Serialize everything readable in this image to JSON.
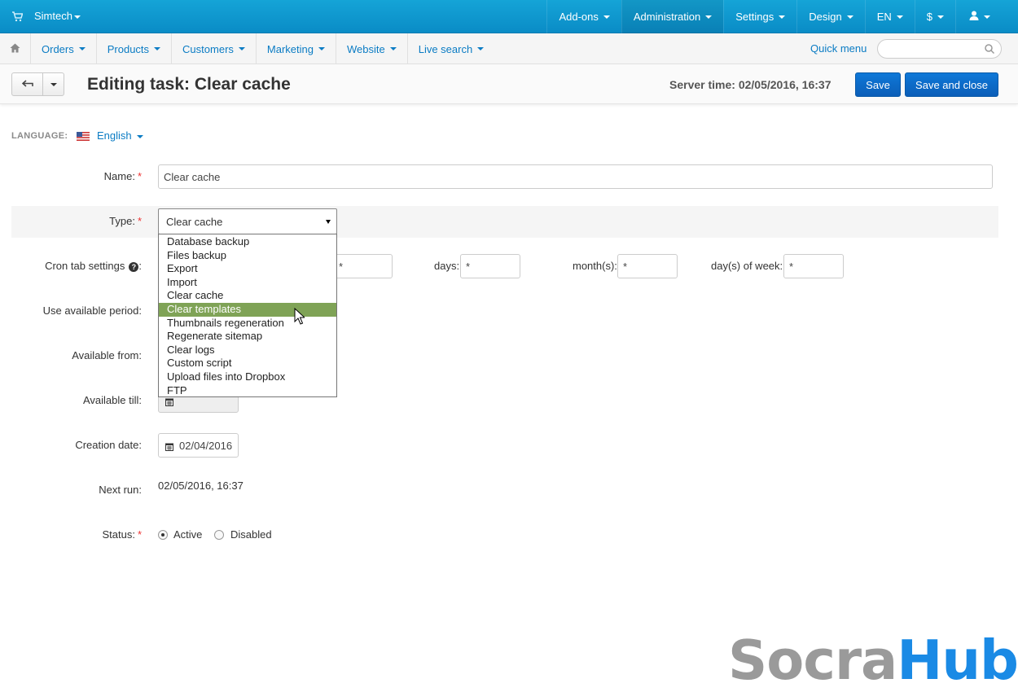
{
  "topbar": {
    "brand": "Simtech",
    "menu": [
      {
        "label": "Add-ons"
      },
      {
        "label": "Administration"
      },
      {
        "label": "Settings"
      },
      {
        "label": "Design"
      },
      {
        "label": "EN"
      },
      {
        "label": "$"
      }
    ]
  },
  "subnav": {
    "menu": [
      {
        "label": "Orders"
      },
      {
        "label": "Products"
      },
      {
        "label": "Customers"
      },
      {
        "label": "Marketing"
      },
      {
        "label": "Website"
      },
      {
        "label": "Live search"
      }
    ],
    "quick_menu": "Quick menu",
    "search_placeholder": ""
  },
  "titlebar": {
    "title": "Editing task: Clear cache",
    "server_time": "Server time: 02/05/2016, 16:37",
    "save": "Save",
    "save_close": "Save and close"
  },
  "language": {
    "label": "LANGUAGE:",
    "value": "English"
  },
  "form": {
    "name_label": "Name:",
    "name_value": "Clear cache",
    "type_label": "Type:",
    "type_value": "Clear cache",
    "type_options": [
      "Database backup",
      "Files backup",
      "Export",
      "Import",
      "Clear cache",
      "Clear templates",
      "Thumbnails regeneration",
      "Regenerate sitemap",
      "Clear logs",
      "Custom script",
      "Upload files into Dropbox",
      "FTP"
    ],
    "type_highlighted": "Clear templates",
    "cron_label": "Cron tab settings",
    "cron_hours_value": "*",
    "cron_days_label": "days:",
    "cron_days_value": "*",
    "cron_months_label": "month(s):",
    "cron_months_value": "*",
    "cron_dow_label": "day(s) of week:",
    "cron_dow_value": "*",
    "period_label": "Use available period:",
    "from_label": "Available from:",
    "till_label": "Available till:",
    "creation_label": "Creation date:",
    "creation_value": "02/04/2016",
    "next_run_label": "Next run:",
    "next_run_value": "02/05/2016, 16:37",
    "status_label": "Status:",
    "status_active": "Active",
    "status_disabled": "Disabled",
    "required_mark": "*"
  },
  "watermark": {
    "part1": "Socra",
    "part2": "Hub"
  },
  "colors": {
    "topbar": "#0a8cc6",
    "link": "#0b7cc4",
    "primary_button": "#0b5eb8",
    "highlight_option": "#7fa356"
  }
}
